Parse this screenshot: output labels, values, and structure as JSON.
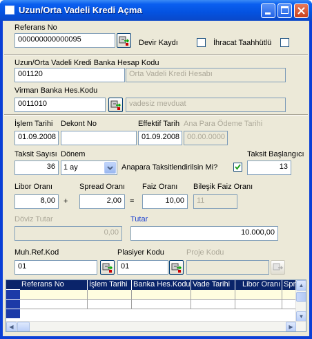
{
  "window": {
    "title": "Uzun/Orta Vadeli Kredi Açma"
  },
  "referans": {
    "label": "Referans No",
    "value": "000000000000095"
  },
  "devir": {
    "label": "Devir Kaydı"
  },
  "ihracat": {
    "label": "İhracat Taahhütlü"
  },
  "banka_hesap": {
    "label": "Uzun/Orta Vadeli Kredi Banka Hesap Kodu",
    "code": "001120",
    "desc": "Orta Vadeli Kredi Hesabı"
  },
  "virman": {
    "label": "Virman Banka Hes.Kodu",
    "code": "0011010",
    "desc": "vadesiz mevduat"
  },
  "islem_tarihi": {
    "label": "İşlem Tarihi",
    "value": "01.09.2008"
  },
  "dekont": {
    "label": "Dekont No",
    "value": ""
  },
  "effektif": {
    "label": "Effektif Tarih",
    "value": "01.09.2008"
  },
  "ana_para": {
    "label": "Ana Para Ödeme Tarihi",
    "value": "00.00.0000"
  },
  "taksit_sayisi": {
    "label": "Taksit Sayısı",
    "value": "36"
  },
  "donem": {
    "label": "Dönem",
    "value": "1 ay"
  },
  "anapara_taksit": {
    "label": "Anapara Taksitlendirilsin Mi?",
    "checked": true
  },
  "taksit_baslangici": {
    "label": "Taksit Başlangıcı",
    "value": "13"
  },
  "libor": {
    "label": "Libor Oranı",
    "value": "8,00"
  },
  "plus": "+",
  "spread": {
    "label": "Spread Oranı",
    "value": "2,00"
  },
  "equals": "=",
  "faiz": {
    "label": "Faiz Oranı",
    "value": "10,00"
  },
  "bilesik": {
    "label": "Bileşik Faiz Oranı",
    "value": "11"
  },
  "doviz": {
    "label": "Döviz Tutar",
    "value": "0,00"
  },
  "tutar": {
    "label": "Tutar",
    "value": "10.000,00"
  },
  "muh_ref": {
    "label": "Muh.Ref.Kod",
    "value": "01"
  },
  "plasiyer": {
    "label": "Plasiyer Kodu",
    "value": "01"
  },
  "proje": {
    "label": "Proje Kodu",
    "value": ""
  },
  "grid": {
    "columns": [
      "Referans No",
      "İşlem Tarihi",
      "Banka Hes.Kodu",
      "Vade Tarihi",
      "Libor Oranı",
      "Spre"
    ]
  },
  "colors": {
    "titlebar": "#0a5ff0",
    "grid_header": "#0a246a",
    "grid_row": "#fffde0"
  }
}
